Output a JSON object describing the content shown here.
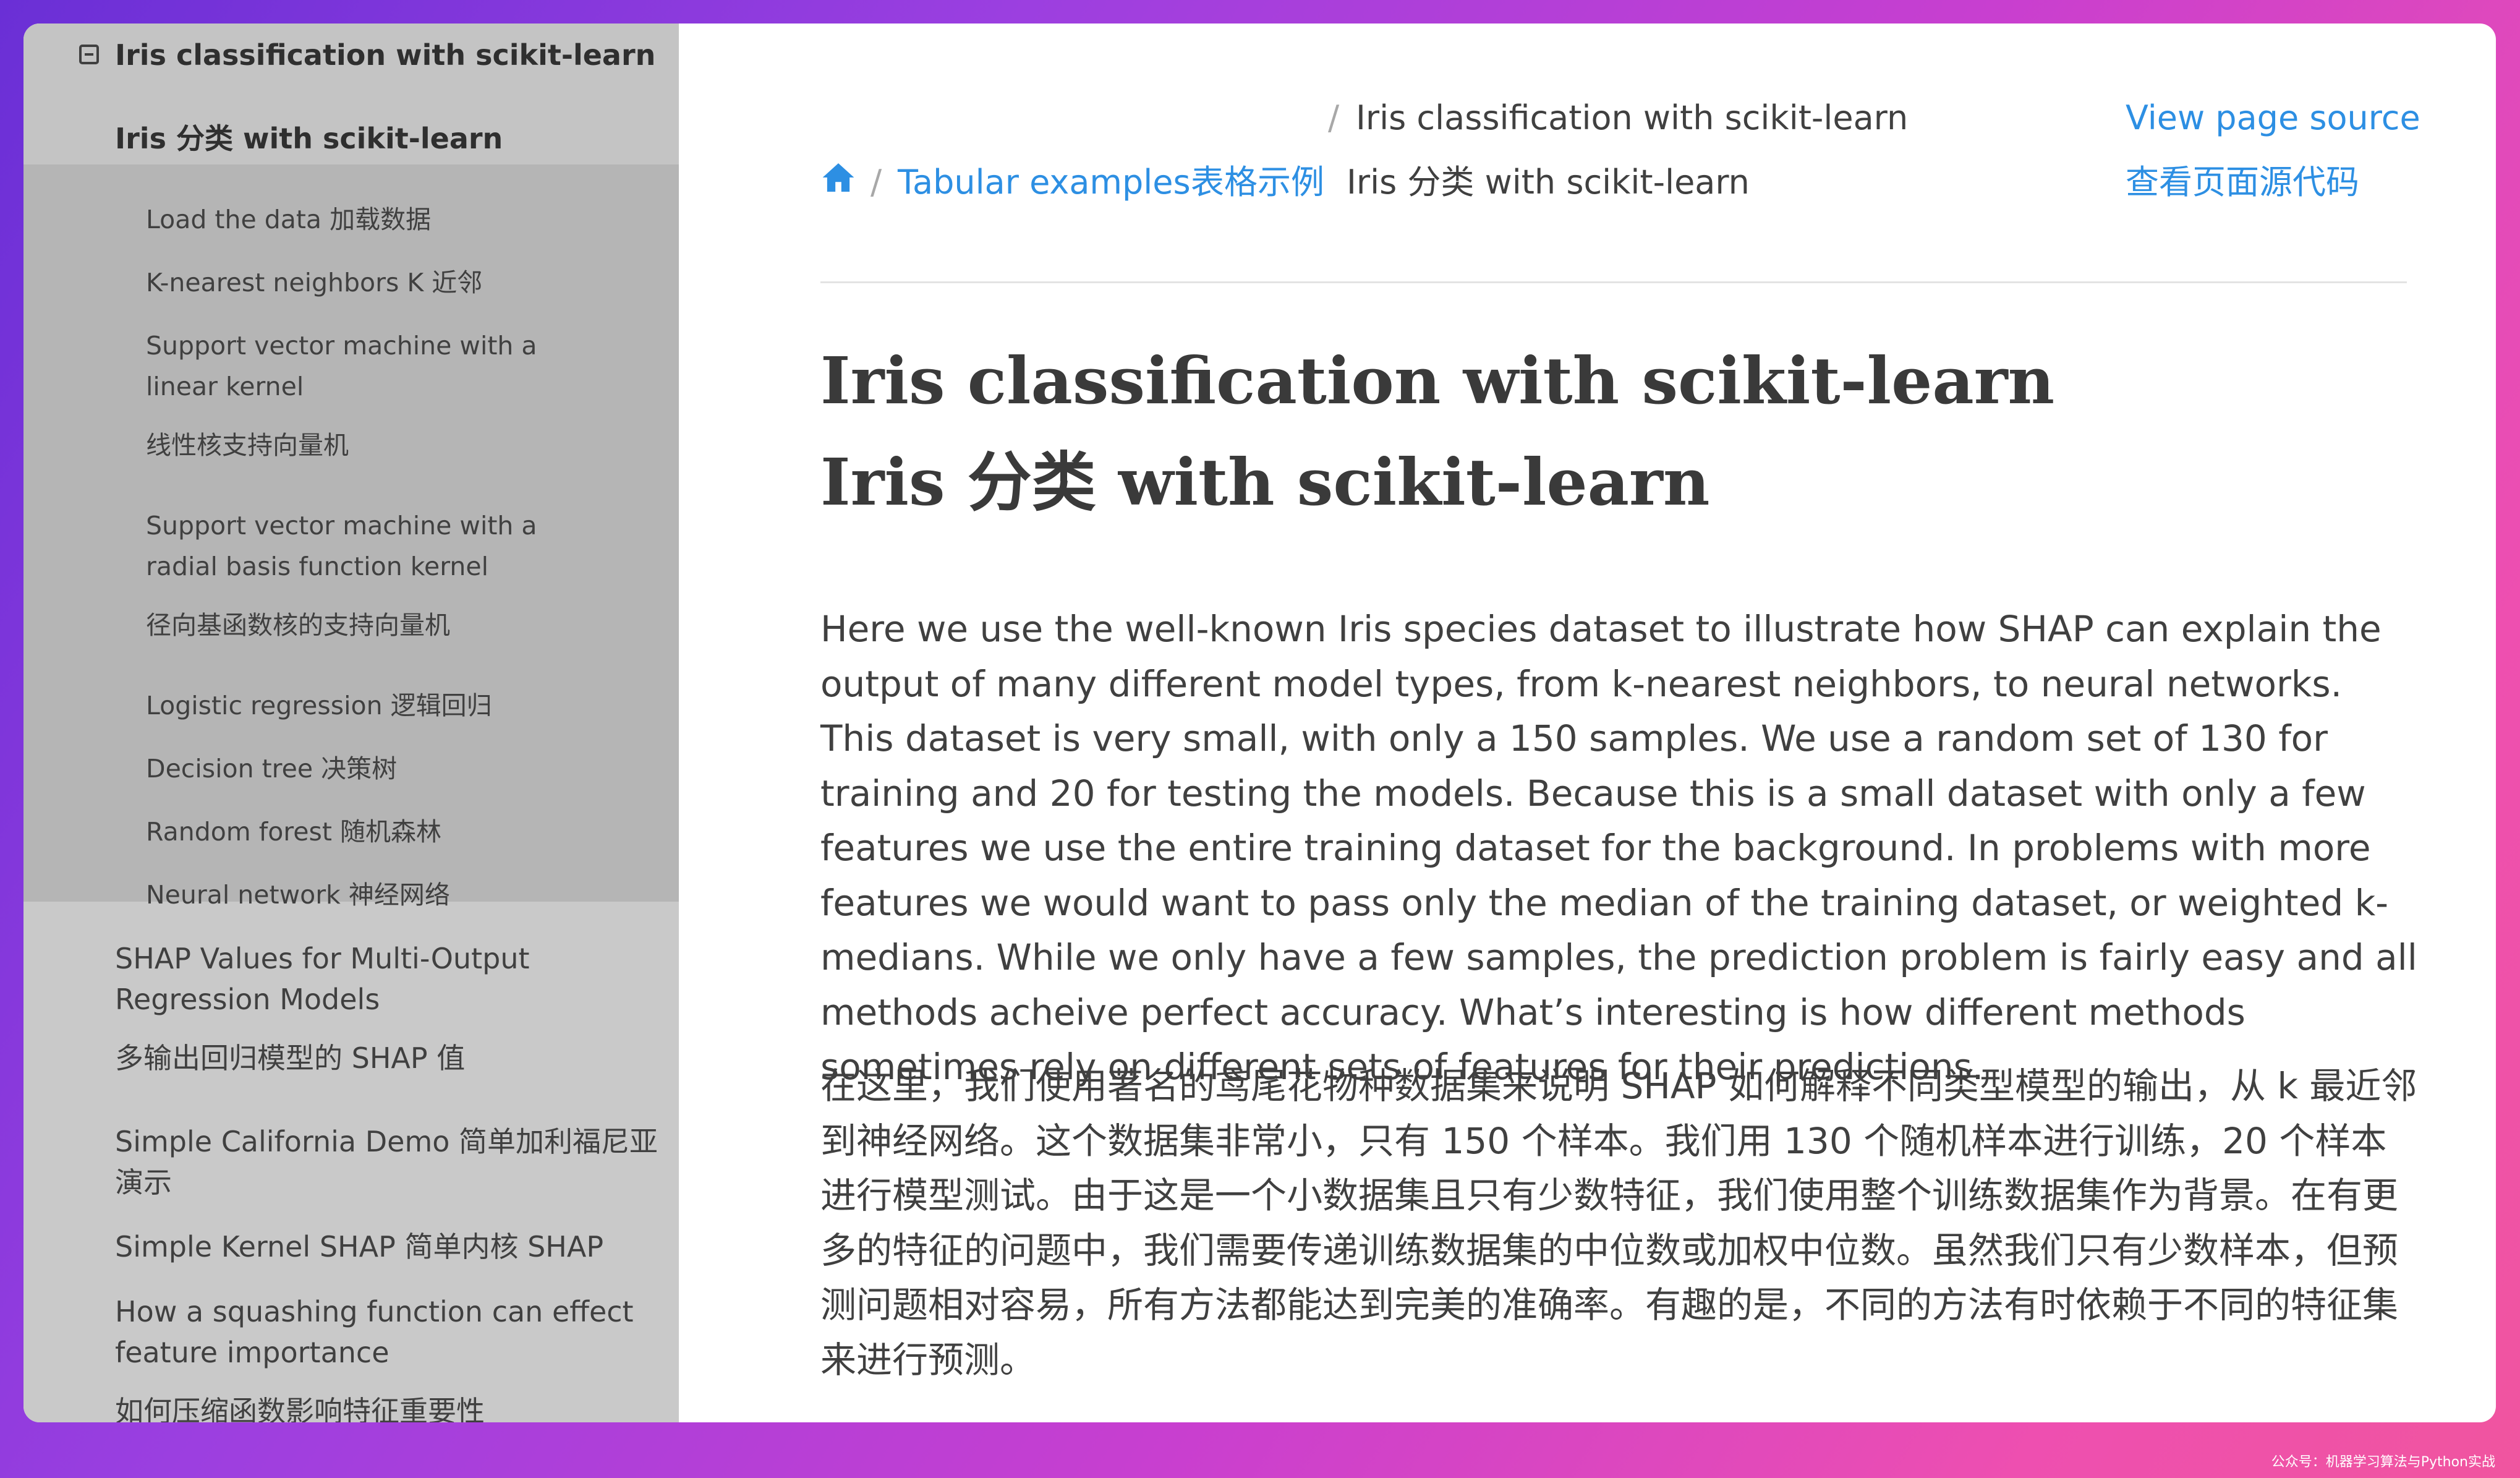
{
  "sidebar": {
    "current_title": "Iris classification with scikit-learn",
    "current_subtitle": "Iris 分类 with scikit-learn",
    "sections": [
      "Load the data  加载数据",
      "K-nearest neighbors  K 近邻",
      "Support vector machine with a linear kernel",
      "线性核支持向量机",
      "Support vector machine with a radial basis function kernel",
      "径向基函数核的支持向量机",
      "Logistic regression  逻辑回归",
      "Decision tree  决策树",
      "Random forest  随机森林",
      "Neural network  神经网络"
    ],
    "other_pages": [
      "SHAP Values for Multi-Output Regression Models",
      "多输出回归模型的 SHAP 值",
      "Simple California Demo  简单加利福尼亚演示",
      "Simple Kernel SHAP  简单内核 SHAP",
      "How a squashing function can effect feature importance",
      "如何压缩函数影响特征重要性"
    ]
  },
  "breadcrumb": {
    "separator": "/",
    "line1_current": "Iris classification with scikit-learn",
    "parent_en": "Tabular examples",
    "parent_zh": "表格示例",
    "line2_current": "Iris 分类 with scikit-learn",
    "view_source_en": "View page source",
    "view_source_zh": "查看页面源代码"
  },
  "page": {
    "title_en": "Iris classification with scikit-learn",
    "title_zh": "Iris 分类 with scikit-learn",
    "para_en": "Here we use the well-known Iris species dataset to illustrate how SHAP can explain the output of many different model types, from k-nearest neighbors, to neural networks. This dataset is very small, with only a 150 samples. We use a random set of 130 for training and 20 for testing the models. Because this is a small dataset with only a few features we use the entire training dataset for the background. In problems with more features we would want to pass only the median of the training dataset, or weighted k-medians. While we only have a few samples, the prediction problem is fairly easy and all methods acheive perfect accuracy. What’s interesting is how different methods sometimes rely on different sets of features for their predictions.",
    "para_zh": "在这里，我们使用著名的鸢尾花物种数据集来说明 SHAP 如何解释不同类型模型的输出，从 k 最近邻到神经网络。这个数据集非常小，只有 150 个样本。我们用 130 个随机样本进行训练，20 个样本进行模型测试。由于这是一个小数据集且只有少数特征，我们使用整个训练数据集作为背景。在有更多的特征的问题中，我们需要传递训练数据集的中位数或加权中位数。虽然我们只有少数样本，但预测问题相对容易，所有方法都能达到完美的准确率。有趣的是，不同的方法有时依赖于不同的特征集来进行预测。"
  },
  "watermark": "公众号：机器学习算法与Python实战",
  "colors": {
    "link": "#2d8fe3",
    "sidebar_bg": "#c9c9c9",
    "sidebar_sub_bg": "#b5b5b5"
  },
  "icons": {
    "home": "home-icon",
    "toggle": "collapse-toggle-icon"
  }
}
